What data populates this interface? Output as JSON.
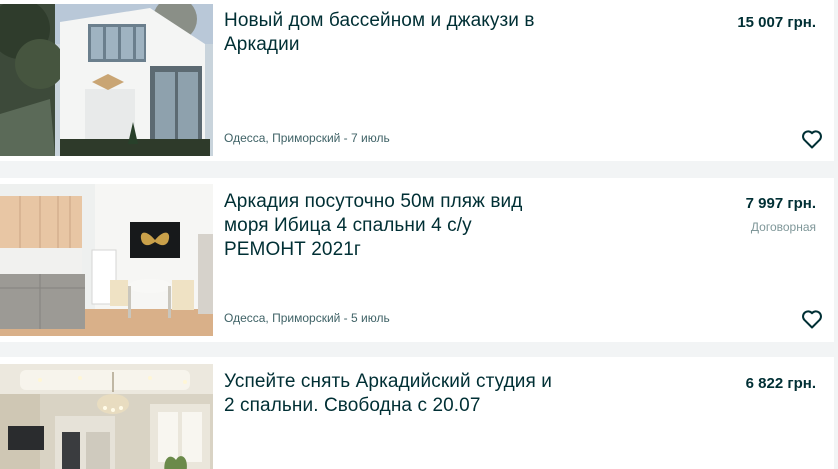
{
  "listings": [
    {
      "title": "Новый дом бассейном и джакузи в Аркадии",
      "price": "15 007 грн.",
      "location_date": "Одесса, Приморский - 7 июль",
      "negotiable": ""
    },
    {
      "title": "Аркадия посуточно 50м пляж вид моря Ибица 4 спальни 4 с/у РЕМОНТ 2021г",
      "price": "7 997 грн.",
      "location_date": "Одесса, Приморский - 5 июль",
      "negotiable": "Договорная"
    },
    {
      "title": "Успейте снять Аркадийский студия и 2 спальни. Свободна с 20.07",
      "price": "6 822 грн.",
      "location_date": "",
      "negotiable": ""
    }
  ],
  "icons": {
    "favorite": "heart-outline-icon"
  },
  "colors": {
    "text_primary": "#002f34",
    "text_secondary": "#406367",
    "text_muted": "#7f9799",
    "background": "#f2f4f5",
    "card": "#ffffff"
  }
}
